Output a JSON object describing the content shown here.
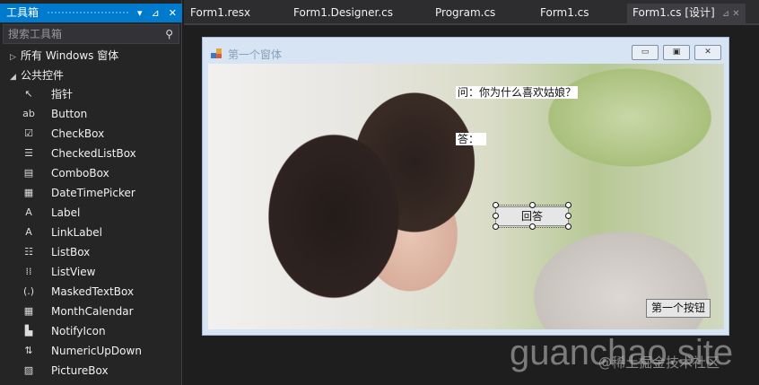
{
  "toolbox": {
    "title": "工具箱",
    "dropdown_glyph": "▾",
    "pin_glyph": "⊿",
    "close_glyph": "✕",
    "search_placeholder": "搜索工具箱",
    "search_icon_glyph": "⚲",
    "categories": [
      {
        "label": "所有 Windows 窗体",
        "expanded": false
      },
      {
        "label": "公共控件",
        "expanded": true
      }
    ],
    "tools": [
      {
        "label": "指针",
        "icon": "pointer-icon",
        "glyph": "↖"
      },
      {
        "label": "Button",
        "icon": "button-icon",
        "glyph": "ab"
      },
      {
        "label": "CheckBox",
        "icon": "checkbox-icon",
        "glyph": "☑"
      },
      {
        "label": "CheckedListBox",
        "icon": "checkedlistbox-icon",
        "glyph": "☰"
      },
      {
        "label": "ComboBox",
        "icon": "combobox-icon",
        "glyph": "▤"
      },
      {
        "label": "DateTimePicker",
        "icon": "datetimepicker-icon",
        "glyph": "▦"
      },
      {
        "label": "Label",
        "icon": "label-icon",
        "glyph": "A"
      },
      {
        "label": "LinkLabel",
        "icon": "linklabel-icon",
        "glyph": "A"
      },
      {
        "label": "ListBox",
        "icon": "listbox-icon",
        "glyph": "☷"
      },
      {
        "label": "ListView",
        "icon": "listview-icon",
        "glyph": "⁞⁞"
      },
      {
        "label": "MaskedTextBox",
        "icon": "maskedtextbox-icon",
        "glyph": "(.)"
      },
      {
        "label": "MonthCalendar",
        "icon": "monthcalendar-icon",
        "glyph": "▦"
      },
      {
        "label": "NotifyIcon",
        "icon": "notifyicon-icon",
        "glyph": "▙"
      },
      {
        "label": "NumericUpDown",
        "icon": "numericupdown-icon",
        "glyph": "⇅"
      },
      {
        "label": "PictureBox",
        "icon": "picturebox-icon",
        "glyph": "▨"
      }
    ]
  },
  "tabs": [
    {
      "label": "Form1.resx"
    },
    {
      "label": "Form1.Designer.cs"
    },
    {
      "label": "Program.cs"
    },
    {
      "label": "Form1.cs"
    },
    {
      "label": "Form1.cs [设计]",
      "active": true
    }
  ],
  "tab_pins_glyph": "⊿ ✕",
  "form": {
    "title": "第一个窗体",
    "minimize_glyph": "▭",
    "maximize_glyph": "▣",
    "close_glyph": "✕",
    "question_label": "问：你为什么喜欢姑娘？",
    "answer_label": "答：",
    "answer_button": "回答",
    "first_button": "第一个按钮"
  },
  "watermark": {
    "text": "guanchao.site",
    "sub": "@稀土掘金技术社区"
  },
  "colors": {
    "accent": "#007acc",
    "background": "#1e1e1e",
    "panel": "#252526"
  }
}
